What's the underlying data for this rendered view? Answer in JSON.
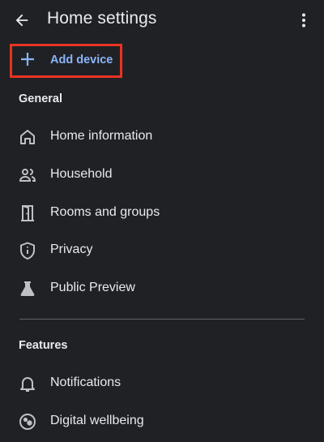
{
  "header": {
    "title": "Home settings",
    "back_icon": "arrow-back-icon",
    "overflow_icon": "more-vert-icon"
  },
  "add_device": {
    "label": "Add device",
    "icon": "plus-icon",
    "accent_color": "#8ab4f8",
    "highlight_color": "#ea3323"
  },
  "sections": [
    {
      "title": "General",
      "items": [
        {
          "label": "Home information",
          "icon": "home-icon"
        },
        {
          "label": "Household",
          "icon": "people-icon"
        },
        {
          "label": "Rooms and groups",
          "icon": "door-icon"
        },
        {
          "label": "Privacy",
          "icon": "shield-info-icon"
        },
        {
          "label": "Public Preview",
          "icon": "flask-icon"
        }
      ]
    },
    {
      "title": "Features",
      "items": [
        {
          "label": "Notifications",
          "icon": "bell-icon"
        },
        {
          "label": "Digital wellbeing",
          "icon": "wellbeing-icon"
        }
      ]
    }
  ],
  "colors": {
    "background": "#202124",
    "text": "#e8eaed",
    "icon": "#bdc1c6",
    "divider": "#5f6368"
  }
}
